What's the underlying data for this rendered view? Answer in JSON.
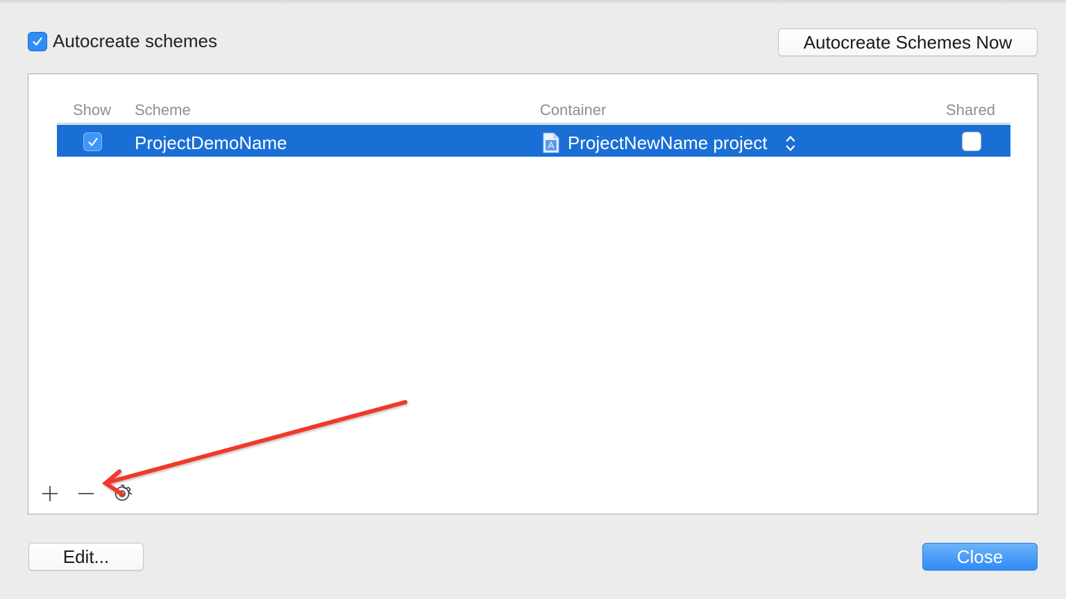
{
  "autocreate": {
    "checkbox_label": "Autocreate schemes",
    "checked": true,
    "now_button_label": "Autocreate Schemes Now"
  },
  "table": {
    "columns": {
      "show": "Show",
      "scheme": "Scheme",
      "container": "Container",
      "shared": "Shared"
    },
    "rows": [
      {
        "show": true,
        "scheme": "ProjectDemoName",
        "container": "ProjectNewName project",
        "container_icon": "xcode-project-file-icon",
        "shared": false,
        "selected": true
      }
    ]
  },
  "toolbar": {
    "add_icon": "plus-icon",
    "remove_icon": "minus-icon",
    "actions_icon": "gear-icon"
  },
  "footer": {
    "edit_label": "Edit...",
    "close_label": "Close"
  },
  "colors": {
    "selection": "#1a6fd6",
    "accent": "#2f8ef5",
    "annotation_arrow": "#f2392b"
  }
}
